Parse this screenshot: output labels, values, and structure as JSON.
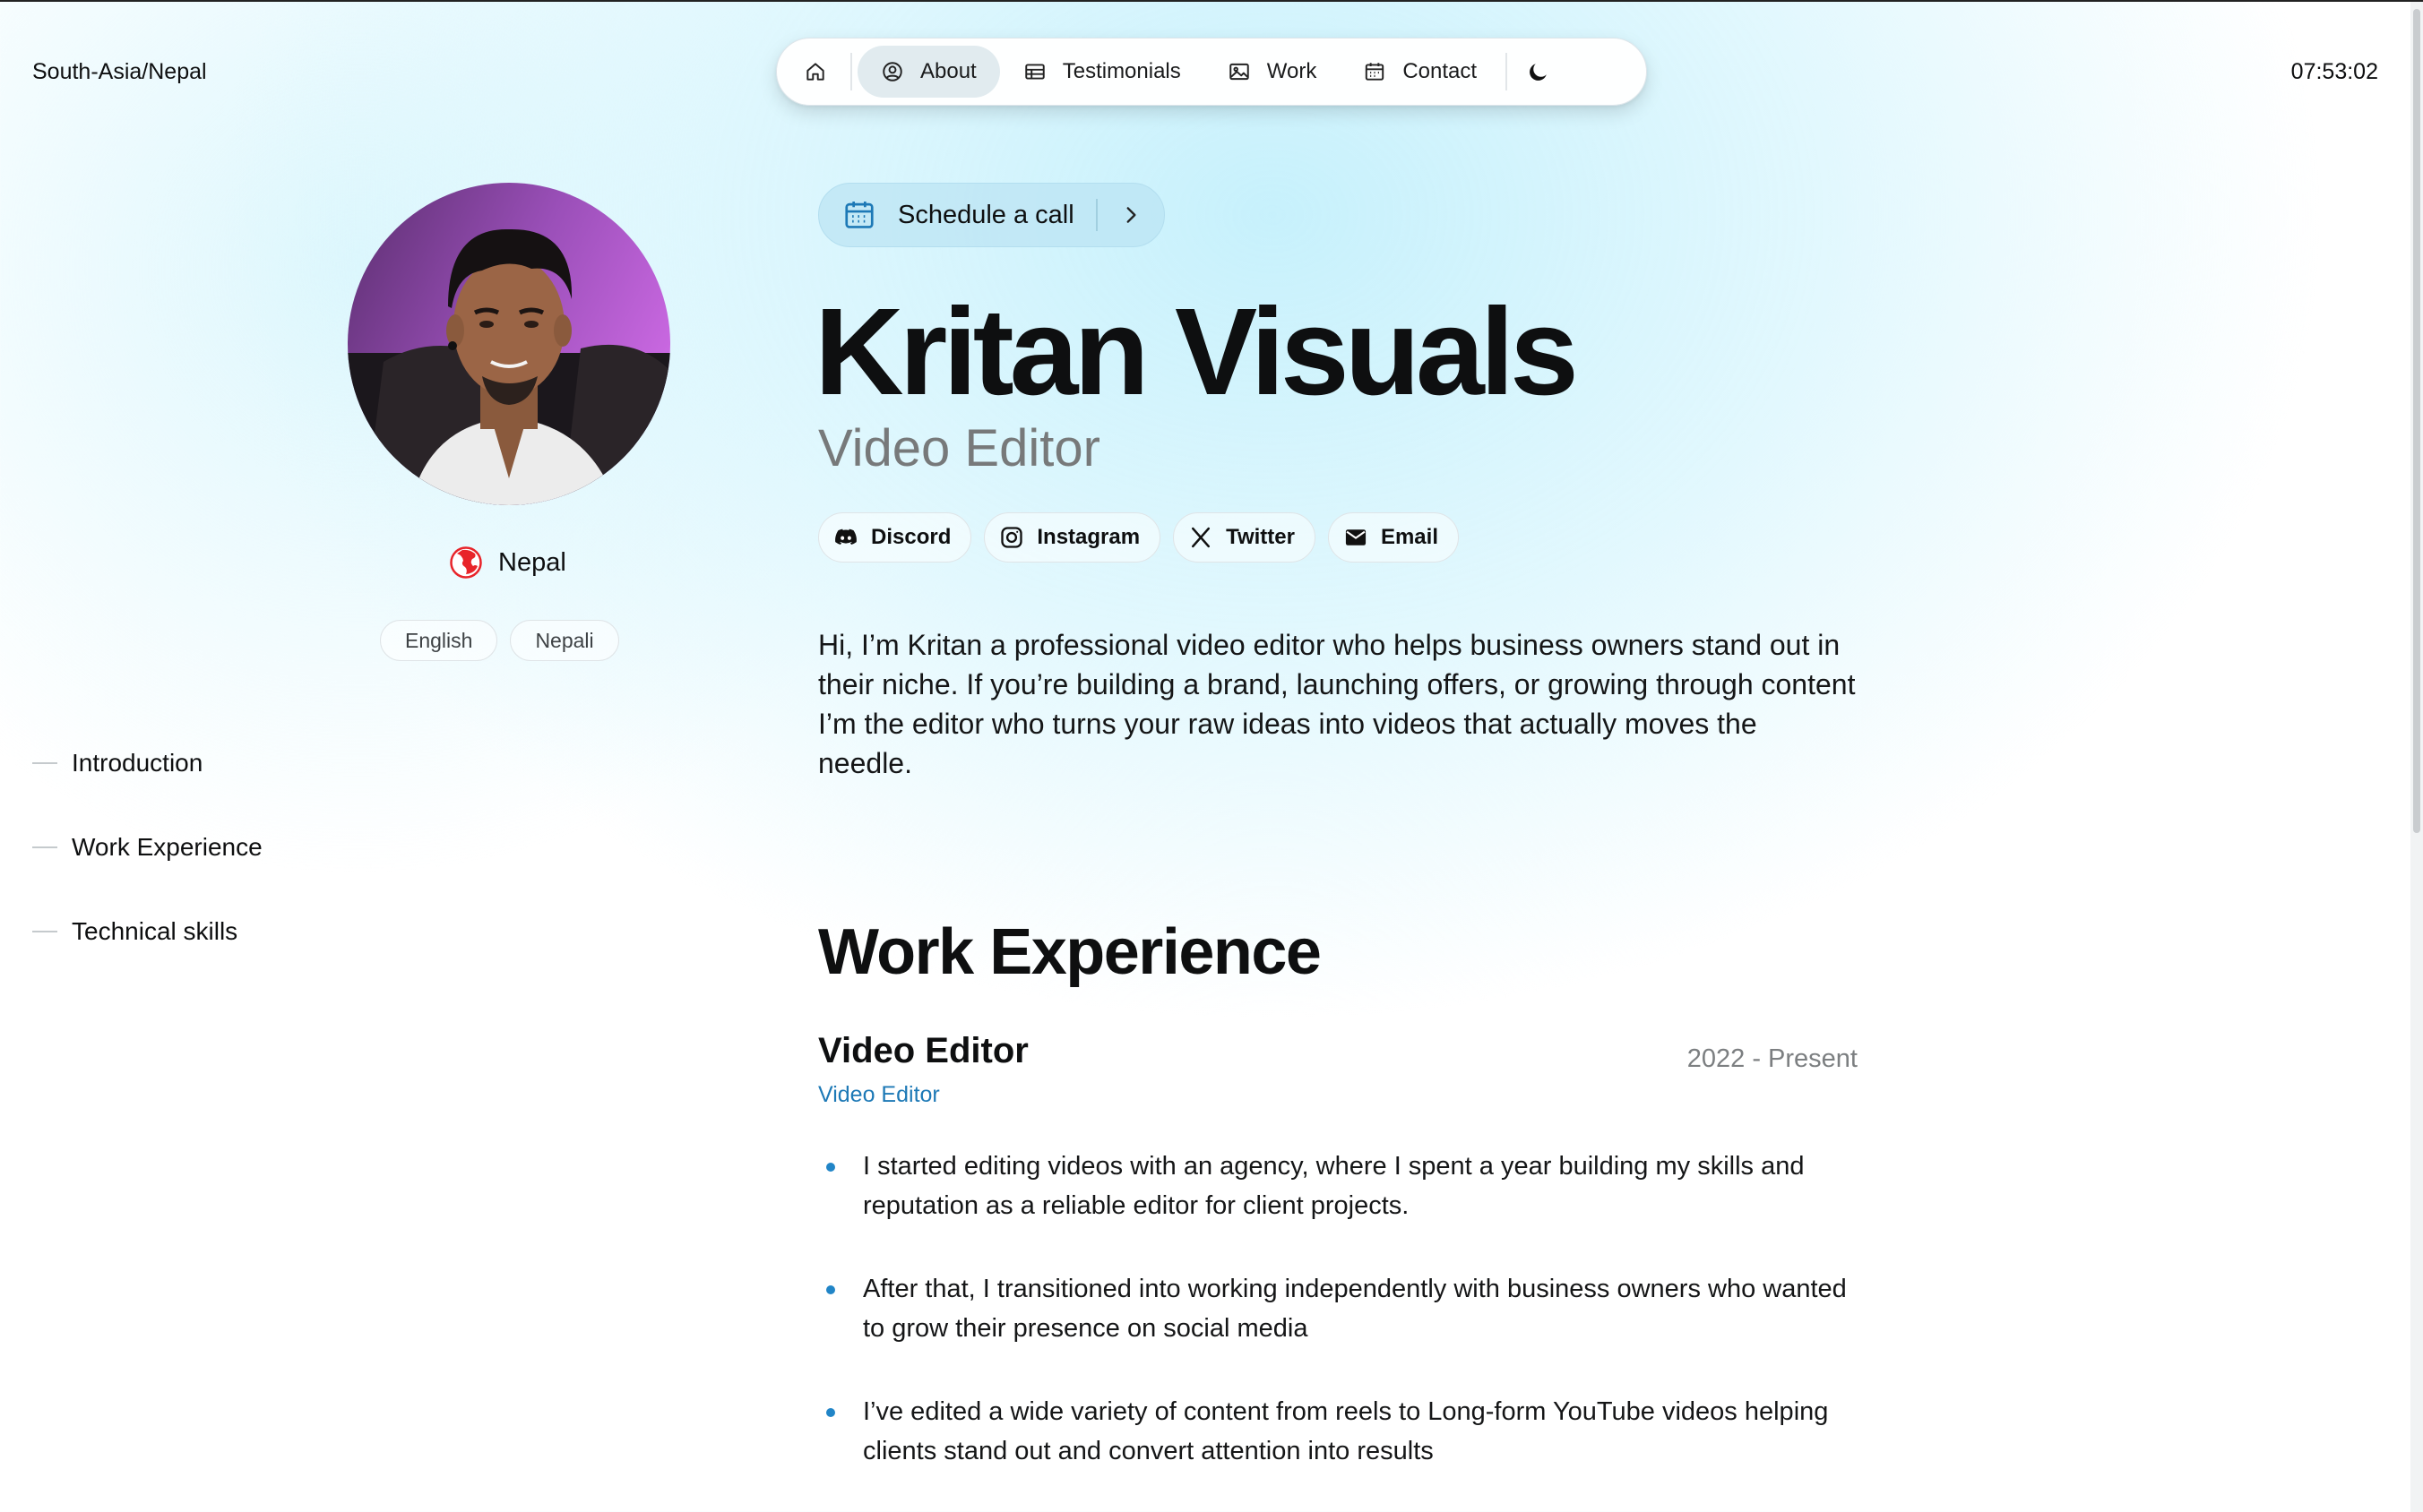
{
  "header": {
    "timezone": "South-Asia/Nepal",
    "time": "07:53:02"
  },
  "nav": {
    "items": [
      {
        "label": "About",
        "icon": "person-circle-icon",
        "active": true
      },
      {
        "label": "Testimonials",
        "icon": "table-icon",
        "active": false
      },
      {
        "label": "Work",
        "icon": "gallery-icon",
        "active": false
      },
      {
        "label": "Contact",
        "icon": "calendar-icon",
        "active": false
      }
    ],
    "home_icon": "home-icon",
    "theme_icon": "moon-icon"
  },
  "profile": {
    "location": "Nepal",
    "languages": [
      "English",
      "Nepali"
    ]
  },
  "toc": [
    "Introduction",
    "Work Experience",
    "Technical skills"
  ],
  "hero": {
    "schedule_label": "Schedule a call",
    "name": "Kritan Visuals",
    "role": "Video Editor",
    "socials": [
      {
        "label": "Discord",
        "icon": "discord-icon"
      },
      {
        "label": "Instagram",
        "icon": "instagram-icon"
      },
      {
        "label": "Twitter",
        "icon": "x-icon"
      },
      {
        "label": "Email",
        "icon": "email-icon"
      }
    ],
    "bio": "Hi, I’m Kritan a professional video editor who helps business owners stand out in their niche. If you’re building a brand, launching offers, or growing through content I’m the editor who turns your raw ideas into videos that actually moves the needle."
  },
  "work": {
    "heading": "Work Experience",
    "job": {
      "title": "Video Editor",
      "company": "Video Editor",
      "dates": "2022 - Present",
      "bullets": [
        "I started editing videos with an agency, where I spent a year building my skills and reputation as a reliable editor for client projects.",
        "After that, I transitioned into working independently with business owners who wanted to grow their presence on social media",
        "I’ve edited a wide variety of content from reels to Long-form YouTube videos helping clients stand out and convert attention into results"
      ]
    }
  },
  "colors": {
    "accent": "#1d79b6",
    "bullet": "#2185c7",
    "schedule_bg": "#b8e2f3"
  }
}
